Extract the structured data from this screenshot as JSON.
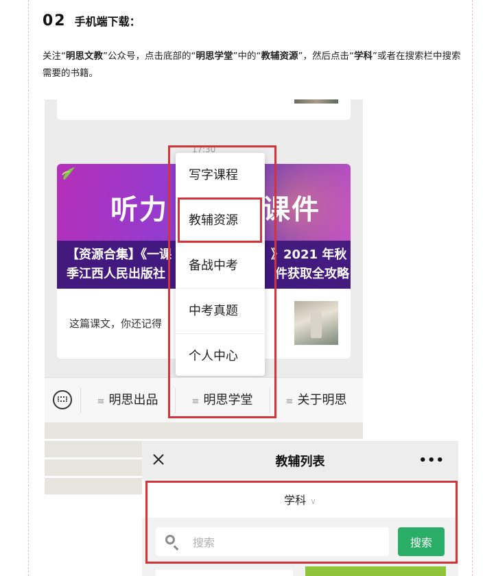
{
  "section": {
    "number": "02",
    "title": "手机端下载："
  },
  "intro": {
    "t1": "关注“",
    "b1": "明思文教",
    "t2": "”公众号，点击底部的“",
    "b2": "明思学堂",
    "t3": "”中的“",
    "b3": "教辅资源",
    "t4": "”，然后点击“",
    "b4": "学科",
    "t5": "”或者在搜索栏中搜索需要的书籍。"
  },
  "chat": {
    "time": "17:30",
    "banner_title_left": "听力",
    "banner_title_right": "课件",
    "banner_line1_left": "【资源合集】《一课",
    "banner_line1_right": "》2021 年秋",
    "banner_line2_left": "季江西人民出版社",
    "banner_line2_right": "件获取全攻略",
    "article_text": "这篇课文，你还记得"
  },
  "menu": {
    "items": [
      "写字课程",
      "教辅资源",
      "备战中考",
      "中考真题",
      "个人中心"
    ]
  },
  "tabs": {
    "items": [
      "明思出品",
      "明思学堂",
      "关于明思"
    ]
  },
  "list_page": {
    "title": "教辅列表",
    "more": "•••",
    "subject_label": "学科",
    "search_placeholder": "搜索",
    "search_button": "搜索"
  },
  "colors": {
    "highlight_red": "#d6323a",
    "search_green": "#2aae67",
    "banner_purple": "#8c3ed4"
  }
}
